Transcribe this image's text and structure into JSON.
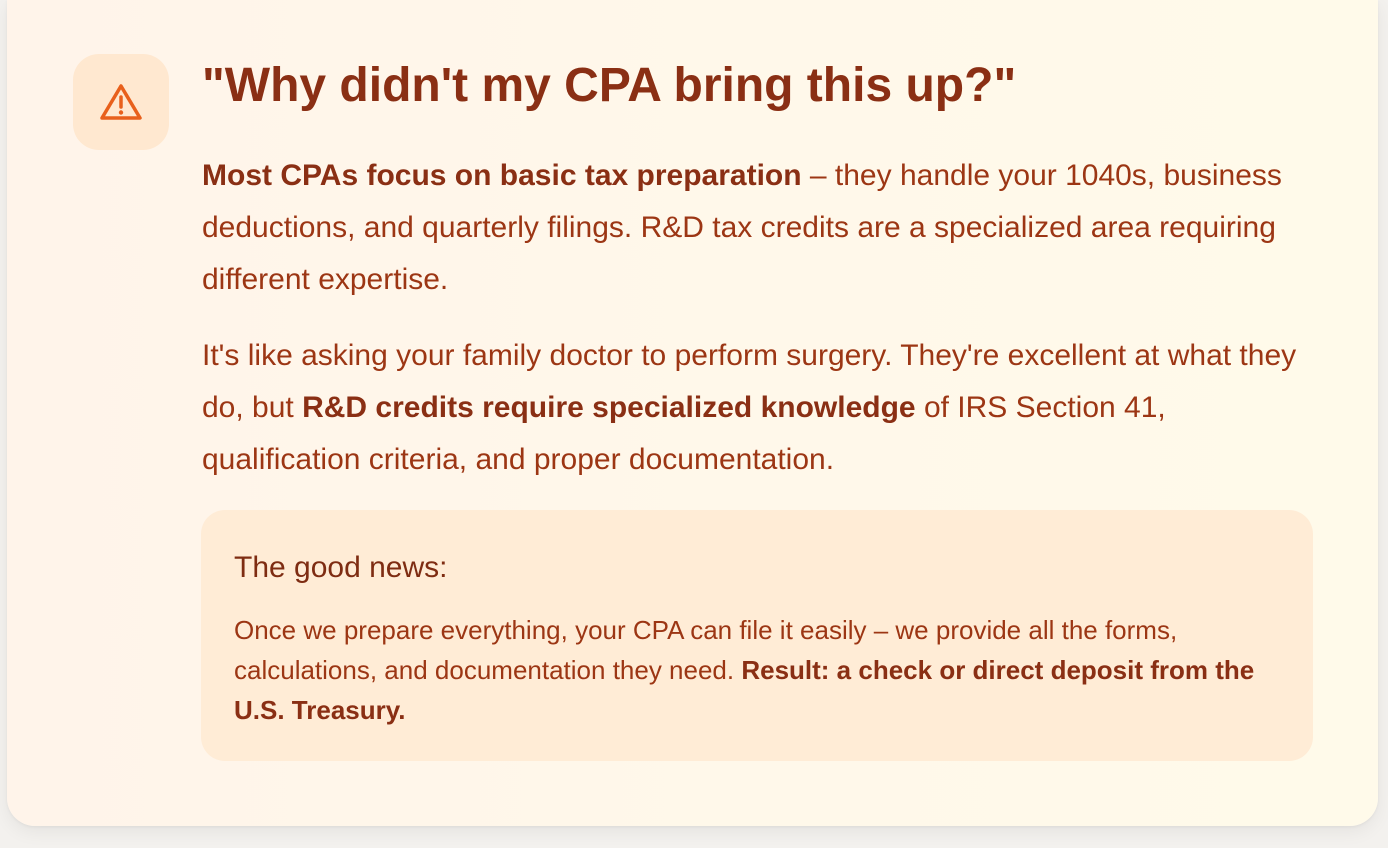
{
  "header": {
    "icon": "warning-triangle-icon",
    "title": "\"Why didn't my CPA bring this up?\""
  },
  "paragraph1": {
    "bold": "Most CPAs focus on basic tax preparation",
    "rest": " – they handle your 1040s, business deductions, and quarterly filings. R&D tax credits are a specialized area requiring different expertise."
  },
  "paragraph2": {
    "before": "It's like asking your family doctor to perform surgery. They're excellent at what they do, but ",
    "bold": "R&D credits require specialized knowledge",
    "after": " of IRS Section 41, qualification criteria, and proper documentation."
  },
  "good_news": {
    "title": "The good news:",
    "text": "Once we prepare everything, your CPA can file it easily – we provide all the forms, calculations, and documentation they need. ",
    "bold": "Result: a check or direct deposit from the U.S. Treasury."
  },
  "colors": {
    "title": "#8a2f14",
    "body": "#9c3614",
    "icon": "#e8601c",
    "icon_bg": "#ffe8d0",
    "callout_bg": "#ffecd6"
  }
}
